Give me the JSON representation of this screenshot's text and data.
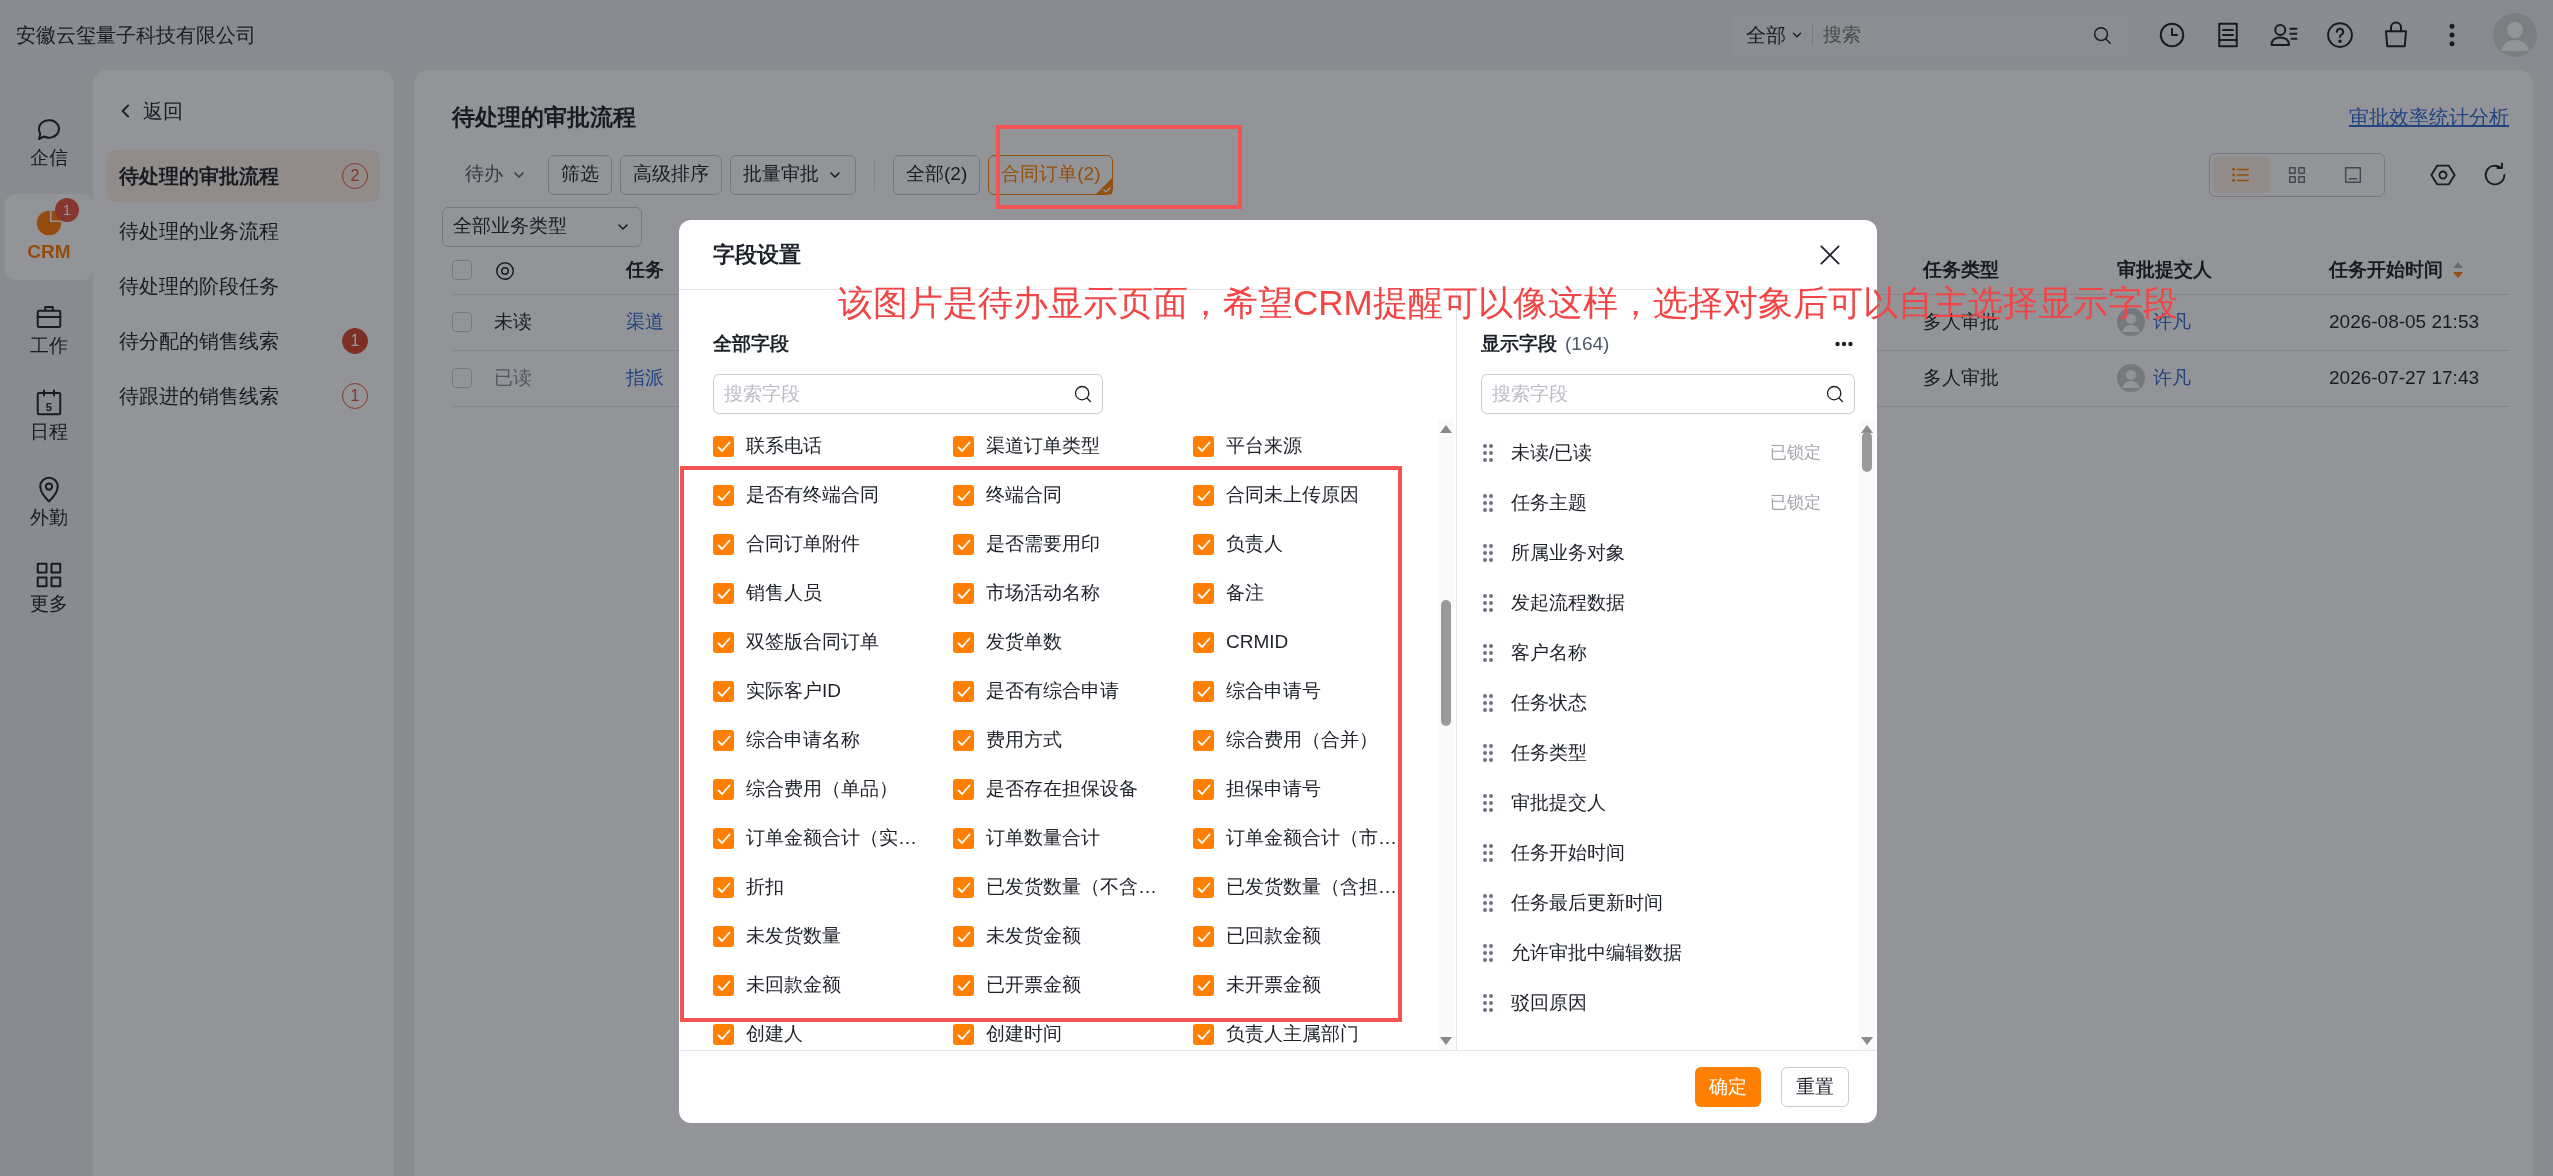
{
  "topbar": {
    "company": "安徽云玺量子科技有限公司",
    "search": {
      "scope": "全部",
      "placeholder": "搜索"
    }
  },
  "rail": [
    {
      "label": "企信",
      "selected": false
    },
    {
      "label": "CRM",
      "selected": true,
      "badge": "1"
    },
    {
      "label": "工作",
      "selected": false
    },
    {
      "label": "日程",
      "selected": false,
      "icon_text": "5"
    },
    {
      "label": "外勤",
      "selected": false
    },
    {
      "label": "更多",
      "selected": false
    }
  ],
  "sidebar": {
    "back": "返回",
    "items": [
      {
        "label": "待处理的审批流程",
        "selected": true,
        "count": "2",
        "filled": false
      },
      {
        "label": "待处理的业务流程",
        "selected": false
      },
      {
        "label": "待处理的阶段任务",
        "selected": false
      },
      {
        "label": "待分配的销售线索",
        "selected": false,
        "count": "1",
        "filled": true
      },
      {
        "label": "待跟进的销售线索",
        "selected": false,
        "count": "1",
        "filled": false
      }
    ]
  },
  "main": {
    "title": "待处理的审批流程",
    "stats_link": "审批效率统计分析",
    "toolbar": [
      {
        "label": "待办",
        "kind": "dropdown-plain"
      },
      {
        "label": "筛选",
        "kind": "button"
      },
      {
        "label": "高级排序",
        "kind": "button"
      },
      {
        "label": "批量审批",
        "kind": "dropdown"
      }
    ],
    "filters": [
      {
        "label": "全部(2)",
        "selected": false
      },
      {
        "label": "合同订单(2)",
        "selected": true
      }
    ],
    "business_type": "全部业务类型",
    "views": [
      {
        "selected": true
      },
      {
        "selected": false
      },
      {
        "selected": false
      }
    ],
    "table": {
      "all_checked": false,
      "columns": [
        "任务",
        "任务类型",
        "审批提交人",
        "任务开始时间"
      ],
      "rows": [
        {
          "checked": false,
          "status": "未读",
          "read": false,
          "subject": "渠道",
          "type": "多人审批",
          "submitter": "许凡",
          "start": "2026-08-05 21:53"
        },
        {
          "checked": false,
          "status": "已读",
          "read": true,
          "subject": "指派",
          "type": "多人审批",
          "submitter": "许凡",
          "start": "2026-07-27 17:43"
        }
      ]
    }
  },
  "dialog": {
    "title": "字段设置",
    "all_fields": {
      "title": "全部字段",
      "placeholder": "搜索字段",
      "fields": [
        {
          "label": "联系电话",
          "checked": true
        },
        {
          "label": "渠道订单类型",
          "checked": true
        },
        {
          "label": "平台来源",
          "checked": true
        },
        {
          "label": "是否有终端合同",
          "checked": true
        },
        {
          "label": "终端合同",
          "checked": true
        },
        {
          "label": "合同未上传原因",
          "checked": true
        },
        {
          "label": "合同订单附件",
          "checked": true
        },
        {
          "label": "是否需要用印",
          "checked": true
        },
        {
          "label": "负责人",
          "checked": true
        },
        {
          "label": "销售人员",
          "checked": true
        },
        {
          "label": "市场活动名称",
          "checked": true
        },
        {
          "label": "备注",
          "checked": true
        },
        {
          "label": "双签版合同订单",
          "checked": true
        },
        {
          "label": "发货单数",
          "checked": true
        },
        {
          "label": "CRMID",
          "checked": true
        },
        {
          "label": "实际客户ID",
          "checked": true
        },
        {
          "label": "是否有综合申请",
          "checked": true
        },
        {
          "label": "综合申请号",
          "checked": true
        },
        {
          "label": "综合申请名称",
          "checked": true
        },
        {
          "label": "费用方式",
          "checked": true
        },
        {
          "label": "综合费用（合并）",
          "checked": true
        },
        {
          "label": "综合费用（单品）",
          "checked": true
        },
        {
          "label": "是否存在担保设备",
          "checked": true
        },
        {
          "label": "担保申请号",
          "checked": true
        },
        {
          "label": "订单金额合计（实…",
          "checked": true
        },
        {
          "label": "订单数量合计",
          "checked": true
        },
        {
          "label": "订单金额合计（市…",
          "checked": true
        },
        {
          "label": "折扣",
          "checked": true
        },
        {
          "label": "已发货数量（不含…",
          "checked": true
        },
        {
          "label": "已发货数量（含担…",
          "checked": true
        },
        {
          "label": "未发货数量",
          "checked": true
        },
        {
          "label": "未发货金额",
          "checked": true
        },
        {
          "label": "已回款金额",
          "checked": true
        },
        {
          "label": "未回款金额",
          "checked": true
        },
        {
          "label": "已开票金额",
          "checked": true
        },
        {
          "label": "未开票金额",
          "checked": true
        },
        {
          "label": "创建人",
          "checked": true
        },
        {
          "label": "创建时间",
          "checked": true
        },
        {
          "label": "负责人主属部门",
          "checked": true
        }
      ]
    },
    "shown": {
      "title": "显示字段",
      "count": "(164)",
      "placeholder": "搜索字段",
      "fields": [
        {
          "label": "未读/已读",
          "note": "已锁定"
        },
        {
          "label": "任务主题",
          "note": "已锁定"
        },
        {
          "label": "所属业务对象"
        },
        {
          "label": "发起流程数据"
        },
        {
          "label": "客户名称"
        },
        {
          "label": "任务状态"
        },
        {
          "label": "任务类型"
        },
        {
          "label": "审批提交人"
        },
        {
          "label": "任务开始时间"
        },
        {
          "label": "任务最后更新时间"
        },
        {
          "label": "允许审批中编辑数据"
        },
        {
          "label": "驳回原因"
        }
      ]
    },
    "confirm": "确定",
    "reset": "重置"
  },
  "annotation": {
    "text": "该图片是待办显示页面，希望CRM提醒可以像这样，选择对象后可以自主选择显示字段"
  }
}
